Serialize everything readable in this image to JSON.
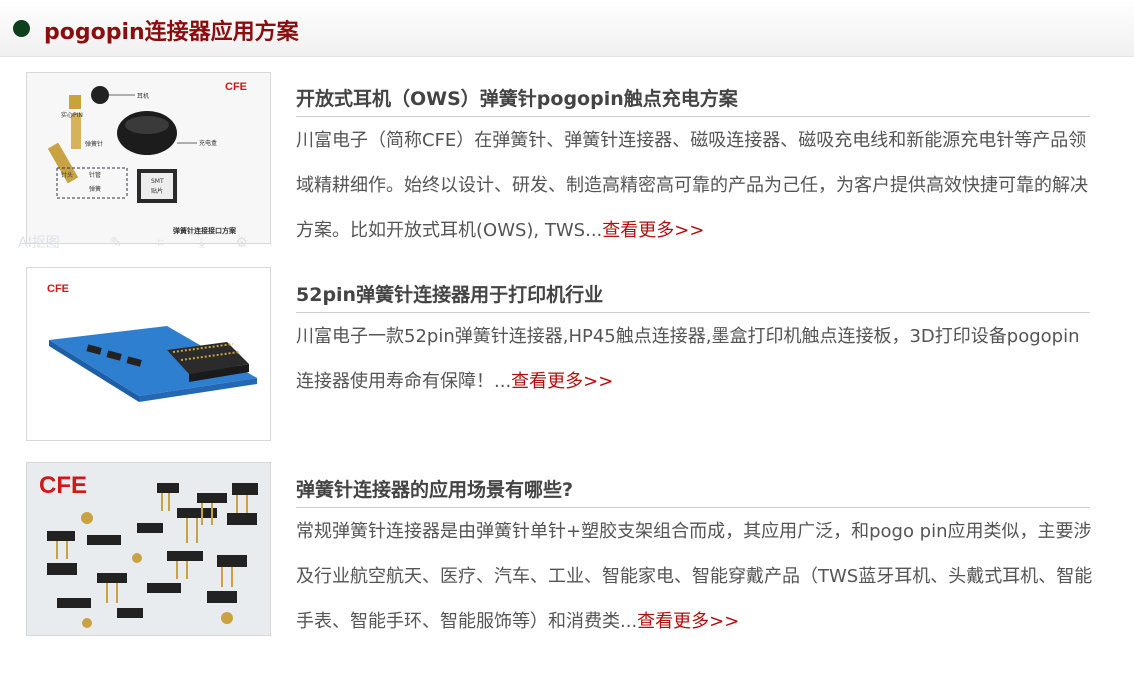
{
  "header": {
    "title": "pogopin连接器应用方案"
  },
  "items": [
    {
      "title": "开放式耳机（OWS）弹簧针pogopin触点充电方案",
      "desc": "川富电子（简称CFE）在弹簧针、弹簧针连接器、磁吸连接器、磁吸充电线和新能源充电针等产品领域精耕细作。始终以设计、研发、制造高精密高可靠的产品为己任，为客户提供高效快捷可靠的解决方案。比如开放式耳机(OWS), TWS...",
      "more": "查看更多>>",
      "image": {
        "brand": "CFE",
        "labels": [
          "耳机",
          "实心PIN",
          "充电盒",
          "弹簧针",
          "针管",
          "针头",
          "弹簧",
          "SMT",
          "贴片",
          "弹簧针连接接口方案"
        ]
      }
    },
    {
      "title": "52pin弹簧针连接器用于打印机行业",
      "desc": "川富电子一款52pin弹簧针连接器,HP45触点连接器,墨盒打印机触点连接板，3D打印设备pogopin连接器使用寿命有保障！...",
      "more": "查看更多>>",
      "image": {
        "brand": "CFE"
      }
    },
    {
      "title": "弹簧针连接器的应用场景有哪些?",
      "desc": "常规弹簧针连接器是由弹簧针单针+塑胶支架组合而成，其应用广泛，和pogo pin应用类似，主要涉及行业航空航天、医疗、汽车、工业、智能家电、智能穿戴产品（TWS蓝牙耳机、头戴式耳机、智能手表、智能手环、智能服饰等）和消费类...",
      "more": "查看更多>>",
      "image": {
        "brand": "CFE"
      }
    }
  ],
  "overlay": {
    "text": "AI抠图"
  },
  "colors": {
    "title_red": "#8b0d0d",
    "link_red": "#b01010",
    "dot_green": "#0e3f1c"
  }
}
